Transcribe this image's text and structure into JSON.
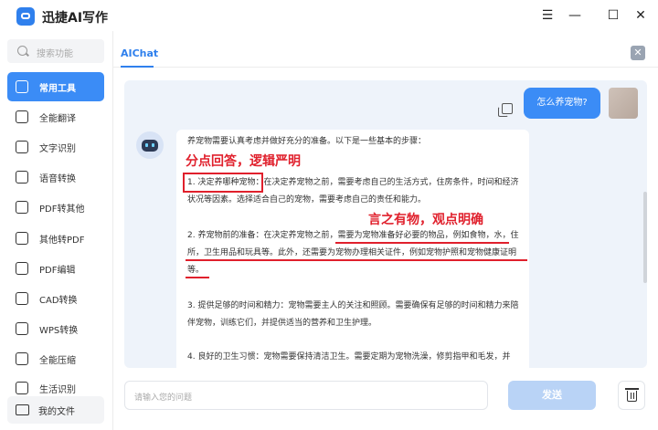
{
  "app": {
    "title": "迅捷AI写作",
    "window_controls": [
      "menu",
      "minimize",
      "maximize",
      "close"
    ]
  },
  "sidebar": {
    "search_placeholder": "搜索功能",
    "items": [
      {
        "label": "常用工具",
        "icon": "toolbox-icon",
        "active": true
      },
      {
        "label": "全能翻译",
        "icon": "translate-icon",
        "active": false
      },
      {
        "label": "文字识别",
        "icon": "text-recognize-icon",
        "active": false
      },
      {
        "label": "语音转换",
        "icon": "voice-icon",
        "active": false
      },
      {
        "label": "PDF转其他",
        "icon": "pdf-convert-icon",
        "active": false
      },
      {
        "label": "其他转PDF",
        "icon": "to-pdf-icon",
        "active": false
      },
      {
        "label": "PDF编辑",
        "icon": "pdf-edit-icon",
        "active": false
      },
      {
        "label": "CAD转换",
        "icon": "cad-icon",
        "active": false
      },
      {
        "label": "WPS转换",
        "icon": "wps-icon",
        "active": false
      },
      {
        "label": "全能压缩",
        "icon": "compress-icon",
        "active": false
      },
      {
        "label": "生活识别",
        "icon": "life-recognize-icon",
        "active": false
      }
    ],
    "my_files": "我的文件"
  },
  "tabs": {
    "active": "AIChat"
  },
  "chat": {
    "user_message": "怎么养宠物?",
    "bot_paragraphs": [
      "养宠物需要认真考虑并做好充分的准备。以下是一些基本的步骤：",
      "1. 决定养哪种宠物：在决定养宠物之前，需要考虑自己的生活方式，住房条件，时间和经济状况等因素。选择适合自己的宠物，需要考虑自己的责任和能力。",
      "2. 养宠物前的准备：在决定养宠物之前，需要为宠物准备好必要的物品，例如食物，水，住所，卫生用品和玩具等。此外，还需要为宠物办理相关证件，例如宠物护照和宠物健康证明等。",
      "3. 提供足够的时间和精力：宠物需要主人的关注和照顾。需要确保有足够的时间和精力来陪伴宠物，训练它们，并提供适当的营养和卫生护理。",
      "4. 良好的卫生习惯：宠物需要保持清洁卫生。需要定期为宠物洗澡，修剪指甲和毛发，并"
    ],
    "annotations": {
      "first": "分点回答，逻辑严明",
      "second": "言之有物，观点明确"
    }
  },
  "input": {
    "placeholder": "请输入您的问题",
    "send_label": "发送"
  },
  "colors": {
    "accent": "#3b8cf6",
    "annotation_red": "#e0202c",
    "send_disabled": "#b9d3f6",
    "chat_bg": "#eef3fa"
  }
}
